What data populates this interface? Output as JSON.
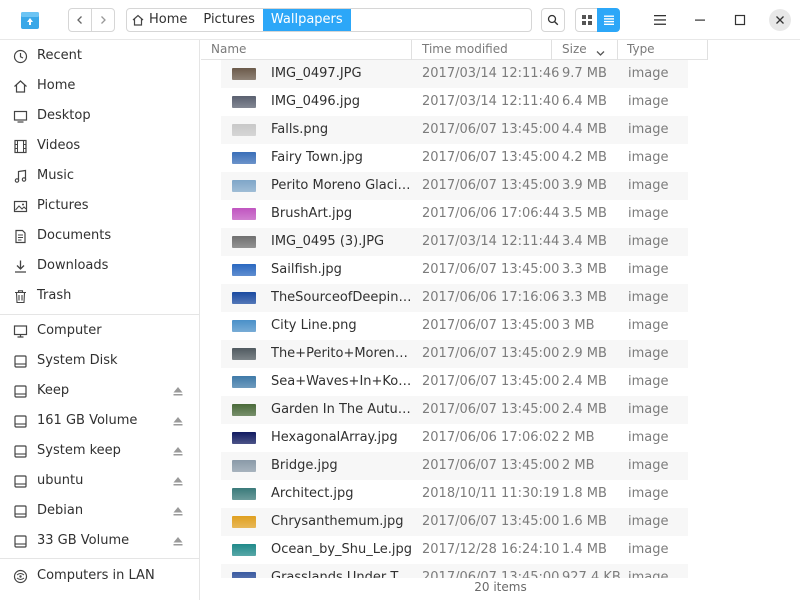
{
  "toolbar": {
    "app_icon": "file-manager-icon",
    "back_icon": "chevron-left-icon",
    "forward_icon": "chevron-right-icon",
    "breadcrumbs": [
      "Home",
      "Pictures",
      "Wallpapers"
    ],
    "search_icon": "search-icon",
    "view_icon_mode": "grid-icon",
    "view_list_mode": "list-icon",
    "menu_icon": "hamburger-icon",
    "minimize_icon": "minimize-icon",
    "maximize_icon": "maximize-icon",
    "close_icon": "close-icon"
  },
  "sidebar": {
    "items": [
      {
        "label": "Recent",
        "icon": "clock-icon"
      },
      {
        "label": "Home",
        "icon": "home-icon"
      },
      {
        "label": "Desktop",
        "icon": "desktop-icon"
      },
      {
        "label": "Videos",
        "icon": "video-icon"
      },
      {
        "label": "Music",
        "icon": "music-icon"
      },
      {
        "label": "Pictures",
        "icon": "picture-icon"
      },
      {
        "label": "Documents",
        "icon": "document-icon"
      },
      {
        "label": "Downloads",
        "icon": "download-icon"
      },
      {
        "label": "Trash",
        "icon": "trash-icon"
      }
    ],
    "devices": [
      {
        "label": "Computer",
        "icon": "computer-icon",
        "eject": false
      },
      {
        "label": "System Disk",
        "icon": "disk-icon",
        "eject": false
      },
      {
        "label": "Keep",
        "icon": "disk-icon",
        "eject": true
      },
      {
        "label": "161 GB Volume",
        "icon": "disk-icon",
        "eject": true
      },
      {
        "label": "System keep",
        "icon": "disk-icon",
        "eject": true
      },
      {
        "label": "ubuntu",
        "icon": "disk-icon",
        "eject": true
      },
      {
        "label": "Debian",
        "icon": "disk-icon",
        "eject": true
      },
      {
        "label": "33 GB Volume",
        "icon": "disk-icon",
        "eject": true
      }
    ],
    "network": [
      {
        "label": "Computers in LAN",
        "icon": "network-icon"
      }
    ]
  },
  "columns": {
    "name": "Name",
    "modified": "Time modified",
    "size": "Size",
    "type": "Type",
    "sort_icon": "chevron-down-icon"
  },
  "files": [
    {
      "name": "IMG_0497.JPG",
      "modified": "2017/03/14 12:11:46",
      "size": "9.7 MB",
      "type": "image",
      "thumb": "#6b5a4a"
    },
    {
      "name": "IMG_0496.jpg",
      "modified": "2017/03/14 12:11:40",
      "size": "6.4 MB",
      "type": "image",
      "thumb": "#5a6070"
    },
    {
      "name": "Falls.png",
      "modified": "2017/06/07 13:45:00",
      "size": "4.4 MB",
      "type": "image",
      "thumb": "#c8c8c8"
    },
    {
      "name": "Fairy Town.jpg",
      "modified": "2017/06/07 13:45:00",
      "size": "4.2 MB",
      "type": "image",
      "thumb": "#3a6fb8"
    },
    {
      "name": "Perito Moreno Glacier.jpg",
      "modified": "2017/06/07 13:45:00",
      "size": "3.9 MB",
      "type": "image",
      "thumb": "#7fa6c8"
    },
    {
      "name": "BrushArt.jpg",
      "modified": "2017/06/06 17:06:44",
      "size": "3.5 MB",
      "type": "image",
      "thumb": "#c055c0"
    },
    {
      "name": "IMG_0495 (3).JPG",
      "modified": "2017/03/14 12:11:44",
      "size": "3.4 MB",
      "type": "image",
      "thumb": "#707070"
    },
    {
      "name": "Sailfish.jpg",
      "modified": "2017/06/07 13:45:00",
      "size": "3.3 MB",
      "type": "image",
      "thumb": "#2a68c0"
    },
    {
      "name": "TheSourceofDeepin.jpg",
      "modified": "2017/06/06 17:16:06",
      "size": "3.3 MB",
      "type": "image",
      "thumb": "#1a4aa0"
    },
    {
      "name": "City Line.png",
      "modified": "2017/06/07 13:45:00",
      "size": "3 MB",
      "type": "image",
      "thumb": "#4a90c8"
    },
    {
      "name": "The+Perito+Moreno+Glacier.jpg",
      "modified": "2017/06/07 13:45:00",
      "size": "2.9 MB",
      "type": "image",
      "thumb": "#505a60"
    },
    {
      "name": "Sea+Waves+In+Koules.jpg",
      "modified": "2017/06/07 13:45:00",
      "size": "2.4 MB",
      "type": "image",
      "thumb": "#3f7aa8"
    },
    {
      "name": "Garden In The Autumn.jpg",
      "modified": "2017/06/07 13:45:00",
      "size": "2.4 MB",
      "type": "image",
      "thumb": "#4a6a3a"
    },
    {
      "name": "HexagonalArray.jpg",
      "modified": "2017/06/06 17:06:02",
      "size": "2 MB",
      "type": "image",
      "thumb": "#101a60"
    },
    {
      "name": "Bridge.jpg",
      "modified": "2017/06/07 13:45:00",
      "size": "2 MB",
      "type": "image",
      "thumb": "#8a9aa8"
    },
    {
      "name": "Architect.jpg",
      "modified": "2018/10/11 11:30:19",
      "size": "1.8 MB",
      "type": "image",
      "thumb": "#3a7a7a"
    },
    {
      "name": "Chrysanthemum.jpg",
      "modified": "2017/06/07 13:45:00",
      "size": "1.6 MB",
      "type": "image",
      "thumb": "#e0a020"
    },
    {
      "name": "Ocean_by_Shu_Le.jpg",
      "modified": "2017/12/28 16:24:10",
      "size": "1.4 MB",
      "type": "image",
      "thumb": "#208a8a"
    },
    {
      "name": "Grasslands Under The...",
      "modified": "2017/06/07 13:45:00",
      "size": "927.4 KB",
      "type": "image",
      "thumb": "#3a5aa0"
    }
  ],
  "status": "20 items",
  "colors": {
    "accent": "#2ca7f8",
    "row_alt": "#f7f7f7"
  }
}
